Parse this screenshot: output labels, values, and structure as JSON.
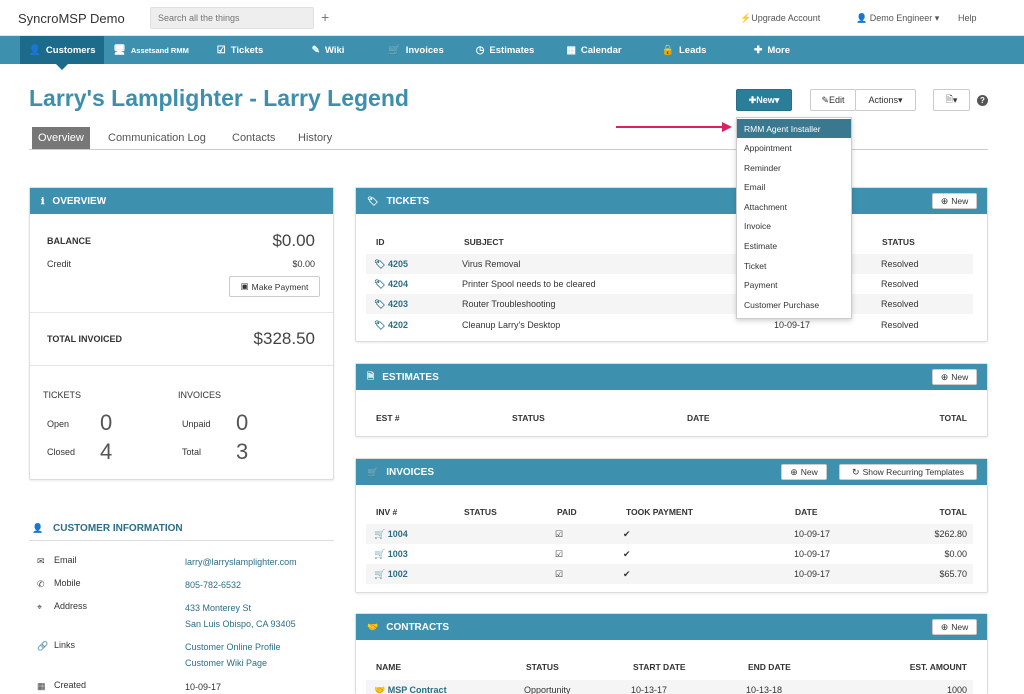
{
  "header": {
    "brand": "SyncroMSP Demo",
    "search_placeholder": "Search all the things",
    "add_symbol": "+",
    "upgrade": "Upgrade Account",
    "user": "Demo Engineer",
    "help": "Help"
  },
  "nav": {
    "customers": "Customers",
    "assets_line1": "Assets",
    "assets_line2": "and RMM",
    "tickets": "Tickets",
    "wiki": "Wiki",
    "invoices": "Invoices",
    "estimates": "Estimates",
    "calendar": "Calendar",
    "leads": "Leads",
    "more": "More"
  },
  "page": {
    "title": "Larry's Lamplighter - Larry Legend",
    "new_label": "New",
    "edit_label": "Edit",
    "actions_label": "Actions"
  },
  "tabs": [
    "Overview",
    "Communication Log",
    "Contacts",
    "History"
  ],
  "new_menu": [
    "RMM Agent Installer",
    "Appointment",
    "Reminder",
    "Email",
    "Attachment",
    "Invoice",
    "Estimate",
    "Ticket",
    "Payment",
    "Customer Purchase"
  ],
  "overview": {
    "title": "OVERVIEW",
    "balance_label": "BALANCE",
    "balance": "$0.00",
    "credit_label": "Credit",
    "credit": "$0.00",
    "make_payment": "Make Payment",
    "total_invoiced_label": "TOTAL INVOICED",
    "total_invoiced": "$328.50",
    "tickets_label": "TICKETS",
    "invoices_label": "INVOICES",
    "open_label": "Open",
    "open": "0",
    "closed_label": "Closed",
    "closed": "4",
    "unpaid_label": "Unpaid",
    "unpaid": "0",
    "total_label": "Total",
    "total": "3"
  },
  "customer_info": {
    "title": "CUSTOMER INFORMATION",
    "email_label": "Email",
    "email": "larry@larryslamplighter.com",
    "mobile_label": "Mobile",
    "mobile": "805-782-6532",
    "address_label": "Address",
    "address1": "433 Monterey St",
    "address2": "San Luis Obispo, CA 93405",
    "links_label": "Links",
    "link1": "Customer Online Profile",
    "link2": "Customer Wiki Page",
    "created_label": "Created",
    "created": "10-09-17"
  },
  "tickets": {
    "title": "TICKETS",
    "new": "New",
    "headers": [
      "ID",
      "SUBJECT",
      "STATUS"
    ],
    "rows": [
      {
        "id": "4205",
        "subject": "Virus Removal",
        "date": "",
        "status": "Resolved"
      },
      {
        "id": "4204",
        "subject": "Printer Spool needs to be cleared",
        "date": "",
        "status": "Resolved"
      },
      {
        "id": "4203",
        "subject": "Router Troubleshooting",
        "date": "",
        "status": "Resolved"
      },
      {
        "id": "4202",
        "subject": "Cleanup Larry's Desktop",
        "date": "10-09-17",
        "status": "Resolved"
      }
    ]
  },
  "estimates": {
    "title": "ESTIMATES",
    "new": "New",
    "headers": [
      "EST #",
      "STATUS",
      "DATE",
      "TOTAL"
    ]
  },
  "invoices": {
    "title": "INVOICES",
    "new": "New",
    "recurring": "Show Recurring Templates",
    "headers": [
      "INV #",
      "STATUS",
      "PAID",
      "TOOK PAYMENT",
      "DATE",
      "TOTAL"
    ],
    "rows": [
      {
        "num": "1004",
        "date": "10-09-17",
        "total": "$262.80"
      },
      {
        "num": "1003",
        "date": "10-09-17",
        "total": "$0.00"
      },
      {
        "num": "1002",
        "date": "10-09-17",
        "total": "$65.70"
      }
    ]
  },
  "contracts": {
    "title": "CONTRACTS",
    "new": "New",
    "headers": [
      "NAME",
      "STATUS",
      "START DATE",
      "END DATE",
      "EST. AMOUNT"
    ],
    "rows": [
      {
        "name": "MSP Contract",
        "status": "Opportunity",
        "start": "10-13-17",
        "end": "10-13-18",
        "amount": "1000"
      }
    ]
  }
}
